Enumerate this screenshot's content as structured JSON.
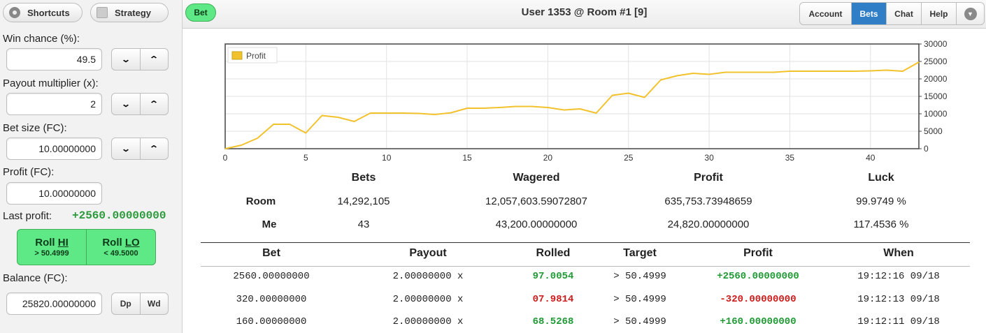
{
  "sidebar": {
    "shortcuts_label": "Shortcuts",
    "strategy_label": "Strategy",
    "win_chance_label": "Win chance (%):",
    "win_chance_value": "49.5",
    "payout_label": "Payout multiplier (x):",
    "payout_value": "2",
    "bet_size_label": "Bet size (FC):",
    "bet_size_value": "10.00000000",
    "profit_label": "Profit (FC):",
    "profit_value": "10.00000000",
    "last_profit_label": "Last profit:",
    "last_profit_value": "+2560.00000000",
    "roll_hi": {
      "prefix": "Roll ",
      "key": "HI",
      "sub": "> 50.4999"
    },
    "roll_lo": {
      "prefix": "Roll ",
      "key": "LO",
      "sub": "< 49.5000"
    },
    "balance_label": "Balance (FC):",
    "balance_value": "25820.00000000",
    "deposit_label": "Dp",
    "withdraw_label": "Wd"
  },
  "header": {
    "bet_label": "Bet",
    "title": "User 1353 @ Room #1 [9]",
    "tabs": [
      {
        "label": "Account",
        "active": false
      },
      {
        "label": "Bets",
        "active": true
      },
      {
        "label": "Chat",
        "active": false
      },
      {
        "label": "Help",
        "active": false
      }
    ]
  },
  "chart_data": {
    "type": "line",
    "title": "",
    "legend": {
      "position": "top-left",
      "entries": [
        "Profit"
      ]
    },
    "series": [
      {
        "name": "Profit",
        "color": "#f2c22d",
        "x": [
          0,
          1,
          2,
          3,
          4,
          5,
          6,
          7,
          8,
          9,
          10,
          11,
          12,
          13,
          14,
          15,
          16,
          17,
          18,
          19,
          20,
          21,
          22,
          23,
          24,
          25,
          26,
          27,
          28,
          29,
          30,
          31,
          32,
          33,
          34,
          35,
          36,
          37,
          38,
          39,
          40,
          41,
          42,
          43
        ],
        "values": [
          0,
          1000,
          3000,
          7000,
          7000,
          4500,
          9500,
          9000,
          7800,
          10200,
          10200,
          10200,
          10100,
          9800,
          10300,
          11600,
          11600,
          11800,
          12100,
          12100,
          11800,
          11100,
          11400,
          10200,
          15300,
          15900,
          14700,
          19700,
          20900,
          21600,
          21300,
          21900,
          21900,
          21900,
          21900,
          22200,
          22200,
          22200,
          22200,
          22200,
          22300,
          22500,
          22200,
          24800
        ]
      }
    ],
    "xlim": [
      0,
      43
    ],
    "ylim": [
      0,
      30000
    ],
    "x_ticks": [
      0,
      5,
      10,
      15,
      20,
      25,
      30,
      35,
      40
    ],
    "y_ticks": [
      0,
      5000,
      10000,
      15000,
      20000,
      25000,
      30000
    ],
    "y_axis_side": "right",
    "grid": true
  },
  "stats": {
    "headers": [
      "Bets",
      "Wagered",
      "Profit",
      "Luck"
    ],
    "rows": [
      {
        "label": "Room",
        "bets": "14,292,105",
        "wagered": "12,057,603.59072807",
        "profit": "635,753.73948659",
        "luck": "99.9749 %"
      },
      {
        "label": "Me",
        "bets": "43",
        "wagered": "43,200.00000000",
        "profit": "24,820.00000000",
        "luck": "117.4536 %"
      }
    ]
  },
  "bets_table": {
    "headers": [
      "Bet",
      "Payout",
      "Rolled",
      "Target",
      "Profit",
      "When"
    ],
    "win_color": "#1f9a34",
    "loss_color": "#cc1b1b",
    "rows": [
      {
        "bet": "2560.00000000",
        "payout": "2.00000000 x",
        "rolled": "97.0054",
        "target": "> 50.4999",
        "profit": "+2560.00000000",
        "when": "19:12:16 09/18",
        "win": true
      },
      {
        "bet": "320.00000000",
        "payout": "2.00000000 x",
        "rolled": "07.9814",
        "target": "> 50.4999",
        "profit": "-320.00000000",
        "when": "19:12:13 09/18",
        "win": false
      },
      {
        "bet": "160.00000000",
        "payout": "2.00000000 x",
        "rolled": "68.5268",
        "target": "> 50.4999",
        "profit": "+160.00000000",
        "when": "19:12:11 09/18",
        "win": true
      }
    ]
  }
}
